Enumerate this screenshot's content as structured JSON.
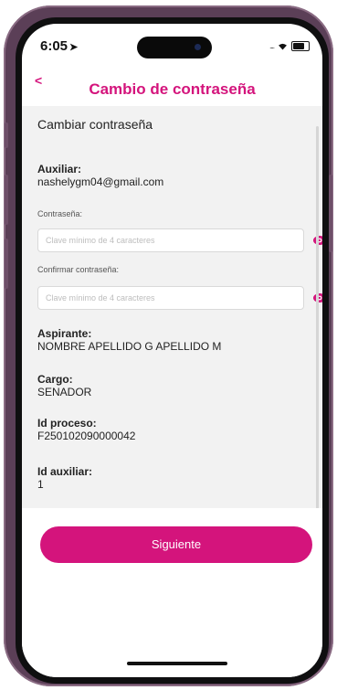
{
  "status_bar": {
    "time": "6:05",
    "signal": "....",
    "battery_level": 0.7
  },
  "header": {
    "back_label": "<",
    "title": "Cambio de contraseña"
  },
  "form": {
    "section_title": "Cambiar contraseña",
    "auxiliar_label": "Auxiliar:",
    "auxiliar_value": "nashelygm04@gmail.com",
    "password_label": "Contraseña:",
    "password_placeholder": "Clave mínimo de 4 caracteres",
    "confirm_label": "Confirmar contraseña:",
    "confirm_placeholder": "Clave mínimo de 4 caracteres"
  },
  "info": {
    "aspirante_label": "Aspirante:",
    "aspirante_value": "NOMBRE APELLIDO G APELLIDO M",
    "cargo_label": "Cargo:",
    "cargo_value": "SENADOR",
    "proceso_label": "Id proceso:",
    "proceso_value": "F250102090000042",
    "auxiliar_id_label": "Id auxiliar:",
    "auxiliar_id_value": "1"
  },
  "actions": {
    "next_label": "Siguiente"
  },
  "colors": {
    "accent": "#d4147c",
    "content_bg": "#f2f2f2",
    "frame": "#5b3f57"
  },
  "icons": {
    "eye": "eye-icon",
    "arrow": "location-arrow-icon"
  }
}
